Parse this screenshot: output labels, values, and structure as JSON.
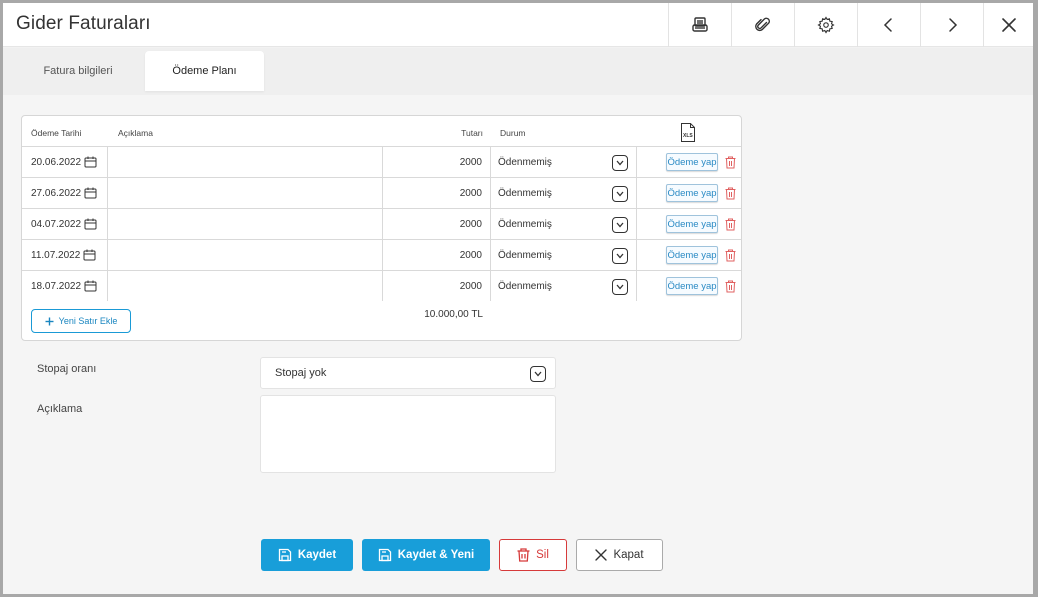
{
  "window": {
    "title": "Gider Faturaları"
  },
  "toolbar": {
    "icons": [
      "print-icon",
      "paperclip-icon",
      "gear-icon",
      "chevron-left-icon",
      "chevron-right-icon",
      "close-icon"
    ]
  },
  "tabs": [
    {
      "label": "Fatura bilgileri",
      "active": false
    },
    {
      "label": "Ödeme Planı",
      "active": true
    }
  ],
  "grid": {
    "headers": {
      "date": "Ödeme Tarihi",
      "description": "Açıklama",
      "amount": "Tutarı",
      "status": "Durum",
      "export_icon_text": "XLS"
    },
    "rows": [
      {
        "date": "20.06.2022",
        "description": "",
        "amount": "2000",
        "status": "Ödenmemiş",
        "action": "Ödeme yap"
      },
      {
        "date": "27.06.2022",
        "description": "",
        "amount": "2000",
        "status": "Ödenmemiş",
        "action": "Ödeme yap"
      },
      {
        "date": "04.07.2022",
        "description": "",
        "amount": "2000",
        "status": "Ödenmemiş",
        "action": "Ödeme yap"
      },
      {
        "date": "11.07.2022",
        "description": "",
        "amount": "2000",
        "status": "Ödenmemiş",
        "action": "Ödeme yap"
      },
      {
        "date": "18.07.2022",
        "description": "",
        "amount": "2000",
        "status": "Ödenmemiş",
        "action": "Ödeme yap"
      }
    ],
    "add_row_label": "Yeni Satır Ekle",
    "total": "10.000,00 TL"
  },
  "form": {
    "withholding_label": "Stopaj oranı",
    "withholding_value": "Stopaj yok",
    "description_label": "Açıklama",
    "description_value": ""
  },
  "buttons": {
    "save": "Kaydet",
    "save_new": "Kaydet & Yeni",
    "delete": "Sil",
    "close": "Kapat"
  },
  "colors": {
    "primary": "#189ed9",
    "danger": "#d63a3a",
    "link": "#2a8ac4"
  }
}
